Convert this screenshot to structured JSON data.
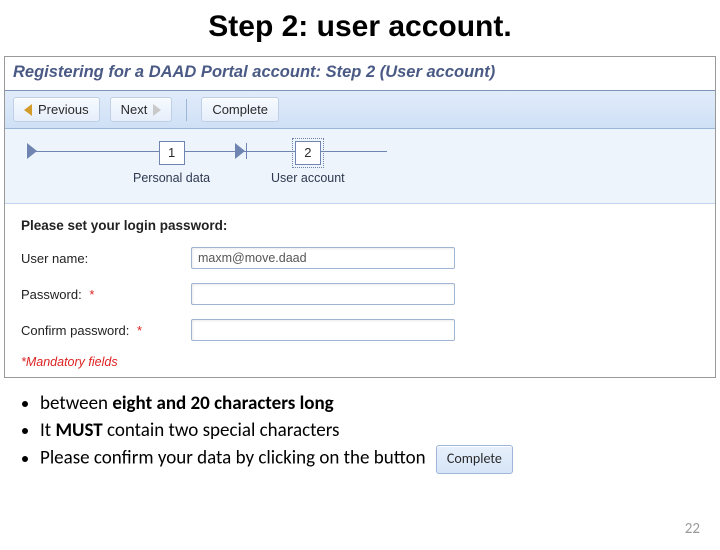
{
  "slide": {
    "title": "Step 2: user account.",
    "page_number": "22"
  },
  "panel": {
    "heading": "Registering for a DAAD Portal account: Step 2 (User account)",
    "buttons": {
      "previous": "Previous",
      "next": "Next",
      "complete": "Complete"
    },
    "wizard": {
      "step1": {
        "num": "1",
        "label": "Personal data"
      },
      "step2": {
        "num": "2",
        "label": "User account"
      }
    },
    "form": {
      "title": "Please set your login password:",
      "username_label": "User name:",
      "username_value": "maxm@move.daad",
      "password_label": "Password:",
      "confirm_label": "Confirm password:",
      "asterisk": "*",
      "mandatory": "*Mandatory fields"
    }
  },
  "info": {
    "line1_pre": "between ",
    "line1_bold": "eight and 20 characters long",
    "line2_pre": "It ",
    "line2_bold": "MUST",
    "line2_post": " contain two special characters",
    "line3": "Please confirm your data by clicking on the button",
    "complete_inline": "Complete"
  }
}
